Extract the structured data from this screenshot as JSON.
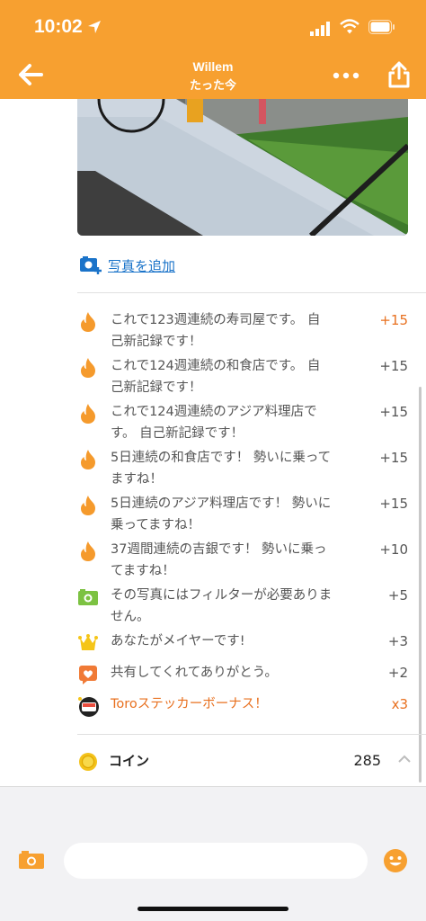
{
  "status": {
    "time": "10:02"
  },
  "header": {
    "title": "Willem",
    "subtitle": "たった今"
  },
  "add_photo": {
    "label": "写真を追加"
  },
  "bonuses": [
    {
      "icon": "flame-icon",
      "line1": "これで123週連続の寿司屋です。 自",
      "line2": "己新記録です！",
      "points": "+15",
      "highlight": true
    },
    {
      "icon": "flame-icon",
      "line1": "これで124週連続の和食店です。 自",
      "line2": "己新記録です！",
      "points": "+15",
      "highlight": false
    },
    {
      "icon": "flame-icon",
      "line1": "これで124週連続のアジア料理店で",
      "line2": "す。 自己新記録です！",
      "points": "+15",
      "highlight": false
    },
    {
      "icon": "flame-icon",
      "line1": "5日連続の和食店です！ 勢いに乗って",
      "line2": "ますね！",
      "points": "+15",
      "highlight": false
    },
    {
      "icon": "flame-icon",
      "line1": "5日連続のアジア料理店です！ 勢いに",
      "line2": "乗ってますね！",
      "points": "+15",
      "highlight": false
    },
    {
      "icon": "flame-icon",
      "line1": "37週間連続の吉銀です！ 勢いに乗っ",
      "line2": "てますね！",
      "points": "+10",
      "highlight": false
    },
    {
      "icon": "camera-icon",
      "line1": "その写真にはフィルターが必要ありま",
      "line2": "せん。",
      "points": "+5",
      "highlight": false
    },
    {
      "icon": "crown-icon",
      "line1": "あなたがメイヤーです!",
      "line2": "",
      "points": "+3",
      "highlight": false
    },
    {
      "icon": "heart-icon",
      "line1": "共有してくれてありがとう。",
      "line2": "",
      "points": "+2",
      "highlight": false
    },
    {
      "icon": "sushi-sticker-icon",
      "line1": "Toroステッカーボーナス！",
      "line2": "",
      "points": "x3",
      "highlight": true
    }
  ],
  "coins": {
    "label": "コイン",
    "value": "285"
  },
  "composer": {
    "placeholder": ""
  },
  "colors": {
    "brand": "#f7a030",
    "accent": "#e8701f",
    "link": "#1a73c9"
  }
}
